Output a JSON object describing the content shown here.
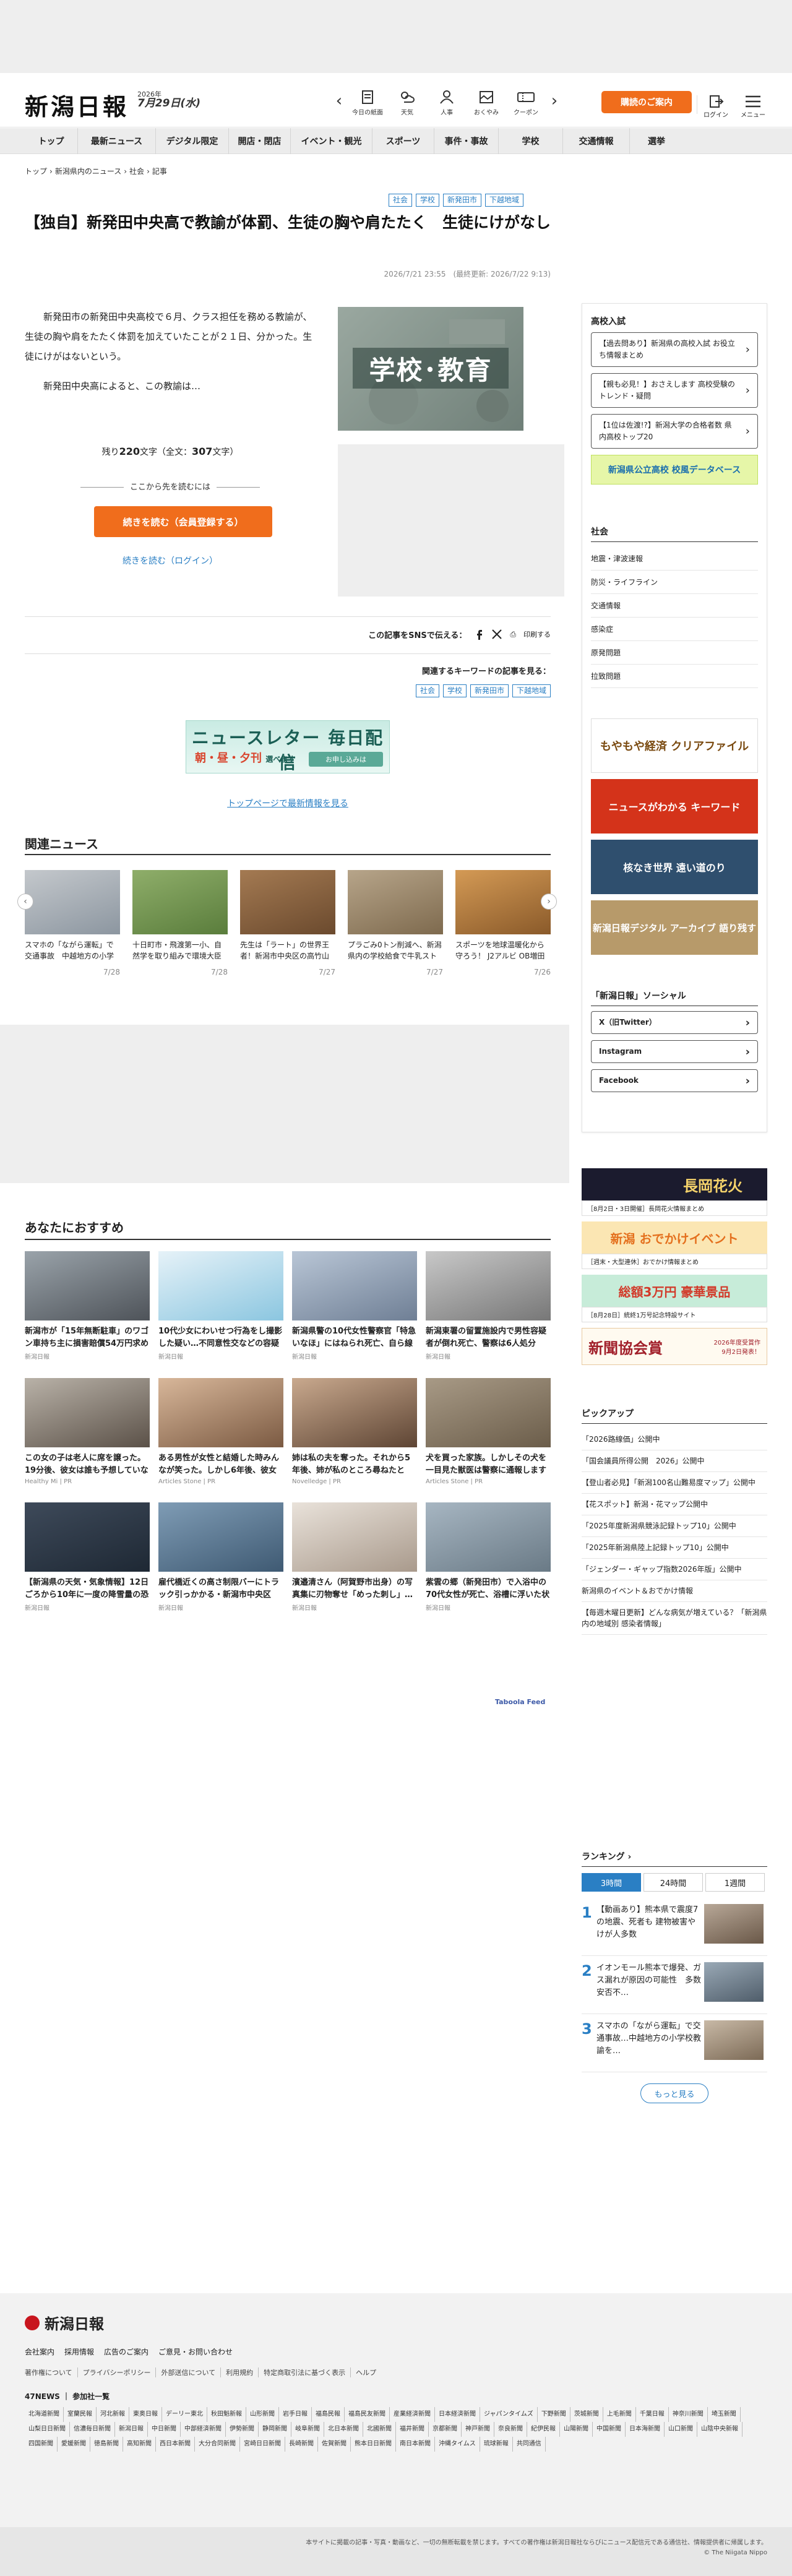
{
  "header": {
    "logo": "新潟日報",
    "date_year": "2026年",
    "date_md": "7月29日(水)",
    "nav": [
      {
        "label": "今日の紙面",
        "icon": "newspaper-icon"
      },
      {
        "label": "天気",
        "icon": "weather-icon"
      },
      {
        "label": "人事",
        "icon": "people-icon"
      },
      {
        "label": "おくやみ",
        "icon": "condolence-icon"
      },
      {
        "label": "クーポン",
        "icon": "coupon-icon"
      }
    ],
    "member_button": "購読のご案内",
    "login": "ログイン",
    "menu": "メニュー"
  },
  "gnav": [
    "トップ",
    "最新ニュース",
    "デジタル限定",
    "開店・閉店",
    "イベント・観光",
    "スポーツ",
    "事件・事故",
    "学校",
    "交通情報",
    "選挙"
  ],
  "breadcrumb": [
    "トップ",
    "›",
    "新潟県内のニュース",
    "›",
    "社会",
    "›",
    "記事"
  ],
  "article": {
    "tags": [
      "社会",
      "学校",
      "新発田市",
      "下越地域"
    ],
    "title": "【独自】新発田中央高で教諭が体罰、生徒の胸や肩たたく　生徒にけがなし",
    "date": "2026/7/21 23:55　(最終更新: 2026/7/22 9:13)",
    "para1": "新発田市の新発田中央高校で６月、クラス担任を務める教諭が、生徒の胸や肩をたたく体罰を加えていたことが２１日、分かった。生徒にけがはないという。",
    "para2": "新発田中央高によると、この教諭は…",
    "image_label": "学校･教育",
    "remain_prefix": "残り",
    "remain_count": "220",
    "remain_mid": "文字（全文：",
    "remain_total": "307",
    "remain_suffix": "文字）",
    "continue_label": "ここから先を読むには",
    "read_button": "続きを読む（会員登録する）",
    "read_login": "続きを読む（ログイン）",
    "share_label": "この記事をSNSで伝える：",
    "print_label": "印刷する",
    "keyword_label": "関連するキーワードの記事を見る：",
    "keyword_tags": [
      "社会",
      "学校",
      "新発田市",
      "下越地域"
    ]
  },
  "newsletter": {
    "title": "ニュースレター 毎日配信",
    "sub": "朝・昼・夕刊",
    "sub2": "選べます",
    "button": "お申し込みは"
  },
  "to_top": "トップページで最新情報を見る",
  "related": {
    "title": "関連ニュース",
    "items": [
      {
        "text": "スマホの「ながら運転」で交通事故　中越地方の小学校教諭を減給…",
        "date": "7/28"
      },
      {
        "text": "十日町市・飛渡第一小、自然学を取り組みで環境大臣表彰！サクラ…",
        "date": "7/28"
      },
      {
        "text": "先生は「ラート」の世界王者！新潟市中央区の高竹山小・後藤優一…",
        "date": "7/27"
      },
      {
        "text": "プラごみ0トン削減へ、新潟県内の学校給食で牛乳ストロー廃止…",
        "date": "7/27"
      },
      {
        "text": "スポーツを地球温暖化から守ろう！ J2アルビ OB増田退人さん…",
        "date": "7/26"
      }
    ]
  },
  "recommend": {
    "title": "あなたにおすすめ",
    "items": [
      {
        "text": "新潟市が「15年無断駐車」のワゴン車持ち主に損害賠償54万円求め提訴、撤去…",
        "src": "新潟日報"
      },
      {
        "text": "10代少女にわいせつ行為をし撮影した疑い…不同意性交などの容疑で新潟市立…",
        "src": "新潟日報"
      },
      {
        "text": "新潟県警の10代女性警察官「特急いなほ」にはねられ死亡、自ら線路内に入っ…",
        "src": "新潟日報"
      },
      {
        "text": "新潟東署の留置施設内で男性容疑者が倒れ死亡、警察は6人処分　監視態勢など問題…",
        "src": "新潟日報"
      },
      {
        "text": "この女の子は老人に席を譲った。19分後、彼女は誰も予想していなかったこと…",
        "src": "Healthy Mi | PR"
      },
      {
        "text": "ある男性が女性と結婚した時みんなが笑った。しかし6年後、彼女が変身した…",
        "src": "Articles Stone | PR"
      },
      {
        "text": "姉は私の夫を奪った。それから5年後、姉が私のところ尋ねたとき、私は青ざめ…",
        "src": "Novelledge | PR"
      },
      {
        "text": "犬を買った家族。しかしその犬を一目見た獣医は警察に通報します",
        "src": "Articles Stone | PR"
      },
      {
        "text": "【新潟県の天気・気象情報】12日ごろから10年に一度の降雪量の恐れ、気象…",
        "src": "新潟日報"
      },
      {
        "text": "雇代橋近くの高さ制限バーにトラック引っかかる・新潟市中央区　10月も付近…",
        "src": "新潟日報"
      },
      {
        "text": "濱邉清さん（阿賀野市出身）の写真集に刃物奪せ「めった刺し」…インス…",
        "src": "新潟日報"
      },
      {
        "text": "紫雲の郷（新発田市）で入浴中の70代女性が死亡、浴槽に浮いた状態で見つか…",
        "src": "新潟日報"
      }
    ],
    "provider": "Taboola Feed"
  },
  "sidebar": {
    "school": {
      "title": "高校入試",
      "buttons": [
        "【過去問あり】新潟県の高校入試 お役立ち情報まとめ",
        "【親も必見！】おさえします 高校受験のトレンド・疑問",
        "【1位は佐渡!?】新潟大学の合格者数 県内高校トップ20"
      ],
      "banner": "新潟県公立高校 校風データベース"
    },
    "society": {
      "title": "社会",
      "links": [
        "地震・津波速報",
        "防災・ライフライン",
        "交通情報",
        "感染症",
        "原発問題",
        "拉致問題"
      ]
    },
    "banners": [
      "もやもや経済 クリアファイル",
      "ニュースがわかる キーワード",
      "核なき世界 遠い道のり",
      "新潟日報デジタル アーカイブ 語り残す"
    ],
    "social_title": "「新潟日報」ソーシャル",
    "social": [
      "X（旧Twitter）",
      "Instagram",
      "Facebook"
    ],
    "promo": [
      {
        "title": "長岡花火",
        "sub": "［8月2日・3日開催］長岡花火情報まとめ"
      },
      {
        "title": "新潟 おでかけイベント",
        "sub": "［週末・大型連休］おでかけ情報まとめ"
      },
      {
        "title": "総額3万円 豪華景品",
        "sub": "［8月28日］統終1万号記念特設サイト"
      },
      {
        "title": "新聞協会賞",
        "sub": "2026年度受賞作 9月2日発表！"
      }
    ],
    "pickup": {
      "title": "ピックアップ",
      "items": [
        "「2026路線価」公開中",
        "「国会議員所得公開　2026」公開中",
        "【登山者必見】「新潟100名山難易度マップ」公開中",
        "【花スポット】新潟・花マップ公開中",
        "「2025年度新潟県競泳記録トップ10」公開中",
        "「2025年新潟県陸上記録トップ10」公開中",
        "「ジェンダー・ギャップ指数2026年版」公開中",
        "新潟県のイベント＆おでかけ情報",
        "【毎週木曜日更新】どんな病気が増えている？「新潟県内の地域別 感染者情報」"
      ]
    },
    "ranking": {
      "title": "ランキング",
      "tabs": [
        "3時間",
        "24時間",
        "1週間"
      ],
      "items": [
        {
          "num": "1",
          "text": "【動画あり】熊本県で震度7の地震、死者も 建物被害やけが人多数"
        },
        {
          "num": "2",
          "text": "イオンモール熊本で爆発、ガス漏れが原因の可能性　多数安否不…"
        },
        {
          "num": "3",
          "text": "スマホの「ながら運転」で交通事故…中越地方の小学校教諭を…"
        }
      ],
      "more": "もっと見る"
    }
  },
  "footer": {
    "logo": "新潟日報",
    "row1": [
      "会社案内",
      "採用情報",
      "広告のご案内",
      "ご意見・お問い合わせ"
    ],
    "row2": [
      "著作権について",
      "プライバシーポリシー",
      "外部送信について",
      "利用規約",
      "特定商取引法に基づく表示",
      "ヘルプ"
    ],
    "title47": "47NEWS ｜ 参加社一覧",
    "links": [
      "北海道新聞",
      "室蘭民報",
      "河北新報",
      "東奥日報",
      "デーリー東北",
      "秋田魁新報",
      "山形新聞",
      "岩手日報",
      "福島民報",
      "福島民友新聞",
      "産業経済新聞",
      "日本経済新聞",
      "ジャパンタイムズ",
      "下野新聞",
      "茨城新聞",
      "上毛新聞",
      "千葉日報",
      "神奈川新聞",
      "埼玉新聞",
      "山梨日日新聞",
      "信濃毎日新聞",
      "新潟日報",
      "中日新聞",
      "中部経済新聞",
      "伊勢新聞",
      "静岡新聞",
      "岐阜新聞",
      "北日本新聞",
      "北國新聞",
      "福井新聞",
      "京都新聞",
      "神戸新聞",
      "奈良新聞",
      "紀伊民報",
      "山陽新聞",
      "中国新聞",
      "日本海新聞",
      "山口新聞",
      "山陰中央新報",
      "四国新聞",
      "愛媛新聞",
      "徳島新聞",
      "高知新聞",
      "西日本新聞",
      "大分合同新聞",
      "宮崎日日新聞",
      "長崎新聞",
      "佐賀新聞",
      "熊本日日新聞",
      "南日本新聞",
      "沖縄タイムス",
      "琉球新報",
      "共同通信"
    ],
    "copy1": "本サイトに掲載の記事・写真・動画など、一切の無断転載を禁じます。すべての著作権は新潟日報社ならびにニュース配信元である通信社、情報提供者に帰属します。",
    "copy2": "© The Niigata Nippo"
  },
  "colors": {
    "accent_orange": "#f06d1c",
    "link_blue": "#2a7fc4",
    "gray_bg": "#eeeeee"
  }
}
